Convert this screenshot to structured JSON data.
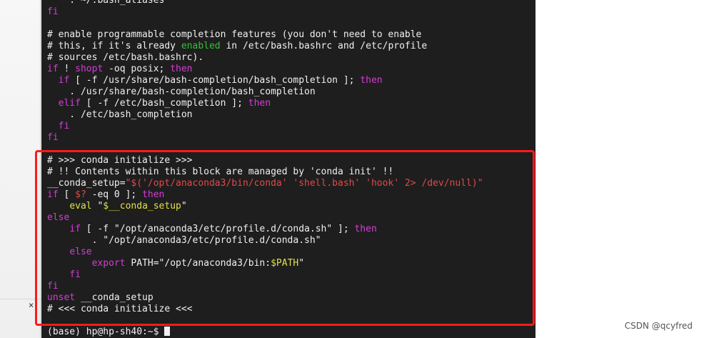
{
  "terminal": {
    "lines": [
      [
        {
          "t": "    . ~/.bash_aliases",
          "c": "plain"
        }
      ],
      [
        {
          "t": "fi",
          "c": "kw"
        }
      ],
      [
        {
          "t": "",
          "c": "plain"
        }
      ],
      [
        {
          "t": "# enable programmable completion features (you don't need to enable",
          "c": "comment"
        }
      ],
      [
        {
          "t": "# this, if it's already ",
          "c": "comment"
        },
        {
          "t": "enabled",
          "c": "green"
        },
        {
          "t": " in /etc/bash.bashrc and /etc/profile",
          "c": "comment"
        }
      ],
      [
        {
          "t": "# sources /etc/bash.bashrc).",
          "c": "comment"
        }
      ],
      [
        {
          "t": "if",
          "c": "kw"
        },
        {
          "t": " ! ",
          "c": "plain"
        },
        {
          "t": "shopt",
          "c": "kw"
        },
        {
          "t": " -oq posix; ",
          "c": "plain"
        },
        {
          "t": "then",
          "c": "kw"
        }
      ],
      [
        {
          "t": "  ",
          "c": "plain"
        },
        {
          "t": "if",
          "c": "kw"
        },
        {
          "t": " [ -f /usr/share/bash-completion/bash_completion ]; ",
          "c": "plain"
        },
        {
          "t": "then",
          "c": "kw"
        }
      ],
      [
        {
          "t": "    . /usr/share/bash-completion/bash_completion",
          "c": "plain"
        }
      ],
      [
        {
          "t": "  ",
          "c": "plain"
        },
        {
          "t": "elif",
          "c": "kw"
        },
        {
          "t": " [ -f /etc/bash_completion ]; ",
          "c": "plain"
        },
        {
          "t": "then",
          "c": "kw"
        }
      ],
      [
        {
          "t": "    . /etc/bash_completion",
          "c": "plain"
        }
      ],
      [
        {
          "t": "  ",
          "c": "plain"
        },
        {
          "t": "fi",
          "c": "kw"
        }
      ],
      [
        {
          "t": "fi",
          "c": "kw"
        }
      ],
      [
        {
          "t": "",
          "c": "plain"
        }
      ],
      [
        {
          "t": "# >>> conda initialize >>>",
          "c": "comment"
        }
      ],
      [
        {
          "t": "# !! Contents within this block are managed by 'conda init' !!",
          "c": "comment"
        }
      ],
      [
        {
          "t": "__conda_setup=",
          "c": "plain"
        },
        {
          "t": "\"$('/opt/anaconda3/bin/conda' 'shell.bash' 'hook' 2> /dev/null)\"",
          "c": "str"
        }
      ],
      [
        {
          "t": "if",
          "c": "kw"
        },
        {
          "t": " [ ",
          "c": "plain"
        },
        {
          "t": "$?",
          "c": "str"
        },
        {
          "t": " -eq 0 ]; ",
          "c": "plain"
        },
        {
          "t": "then",
          "c": "kw"
        }
      ],
      [
        {
          "t": "    ",
          "c": "plain"
        },
        {
          "t": "eval",
          "c": "op"
        },
        {
          "t": " \"",
          "c": "plain"
        },
        {
          "t": "$__conda_setup",
          "c": "op"
        },
        {
          "t": "\"",
          "c": "plain"
        }
      ],
      [
        {
          "t": "else",
          "c": "kw"
        }
      ],
      [
        {
          "t": "    ",
          "c": "plain"
        },
        {
          "t": "if",
          "c": "kw"
        },
        {
          "t": " [ -f \"/opt/anaconda3/etc/profile.d/conda.sh\" ]; ",
          "c": "plain"
        },
        {
          "t": "then",
          "c": "kw"
        }
      ],
      [
        {
          "t": "        . \"/opt/anaconda3/etc/profile.d/conda.sh\"",
          "c": "plain"
        }
      ],
      [
        {
          "t": "    ",
          "c": "plain"
        },
        {
          "t": "else",
          "c": "kw"
        }
      ],
      [
        {
          "t": "        ",
          "c": "plain"
        },
        {
          "t": "export",
          "c": "kw"
        },
        {
          "t": " PATH=\"/opt/anaconda3/bin:",
          "c": "plain"
        },
        {
          "t": "$PATH",
          "c": "op"
        },
        {
          "t": "\"",
          "c": "plain"
        }
      ],
      [
        {
          "t": "    ",
          "c": "plain"
        },
        {
          "t": "fi",
          "c": "kw"
        }
      ],
      [
        {
          "t": "fi",
          "c": "kw"
        }
      ],
      [
        {
          "t": "unset",
          "c": "kw"
        },
        {
          "t": " __conda_setup",
          "c": "plain"
        }
      ],
      [
        {
          "t": "# <<< conda initialize <<<",
          "c": "comment"
        }
      ],
      [
        {
          "t": "",
          "c": "plain"
        }
      ],
      [
        {
          "t": "(base) hp@hp-sh40:~$ ",
          "c": "plain"
        }
      ]
    ]
  },
  "left_pane": {
    "scroll_mark": "×"
  },
  "watermark": "CSDN @qcyfred",
  "colors": {
    "terminal_bg": "#1e1e1e",
    "keyword": "#d63cd6",
    "string": "#e04a4a",
    "variable": "#e0e04a",
    "green": "#34c234",
    "highlight_border": "#ff1a1a"
  }
}
